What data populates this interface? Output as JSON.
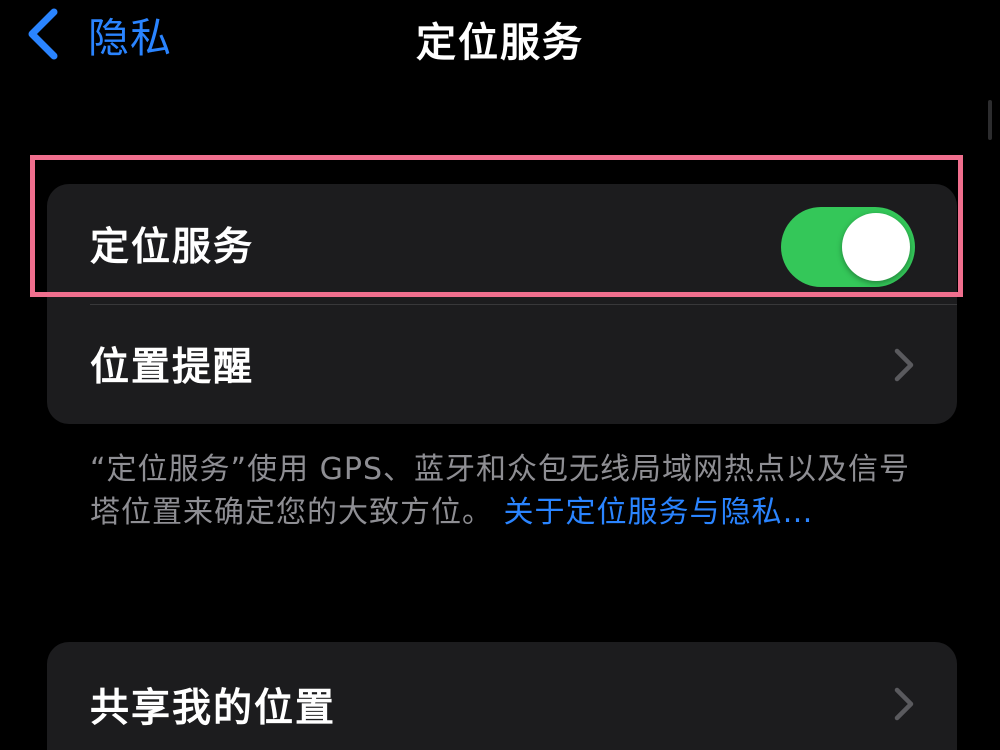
{
  "nav": {
    "back_label": "隐私",
    "title": "定位服务"
  },
  "settings": {
    "location_services": {
      "label": "定位服务",
      "toggle_on": true
    },
    "location_alerts": {
      "label": "位置提醒"
    },
    "share_my_location": {
      "label": "共享我的位置"
    }
  },
  "footnote": {
    "text": "“定位服务”使用 GPS、蓝牙和众包无线局域网热点以及信号塔位置来确定您的大致方位。",
    "link": "关于定位服务与隐私…"
  },
  "icons": {
    "back": "chevron-left-icon",
    "disclosure": "chevron-right-icon"
  },
  "colors": {
    "background": "#000000",
    "cell": "#1c1c1e",
    "accent_blue": "#2a84ff",
    "toggle_green": "#34c759",
    "secondary_text": "#8e8e93",
    "highlight": "#f06f8e"
  }
}
